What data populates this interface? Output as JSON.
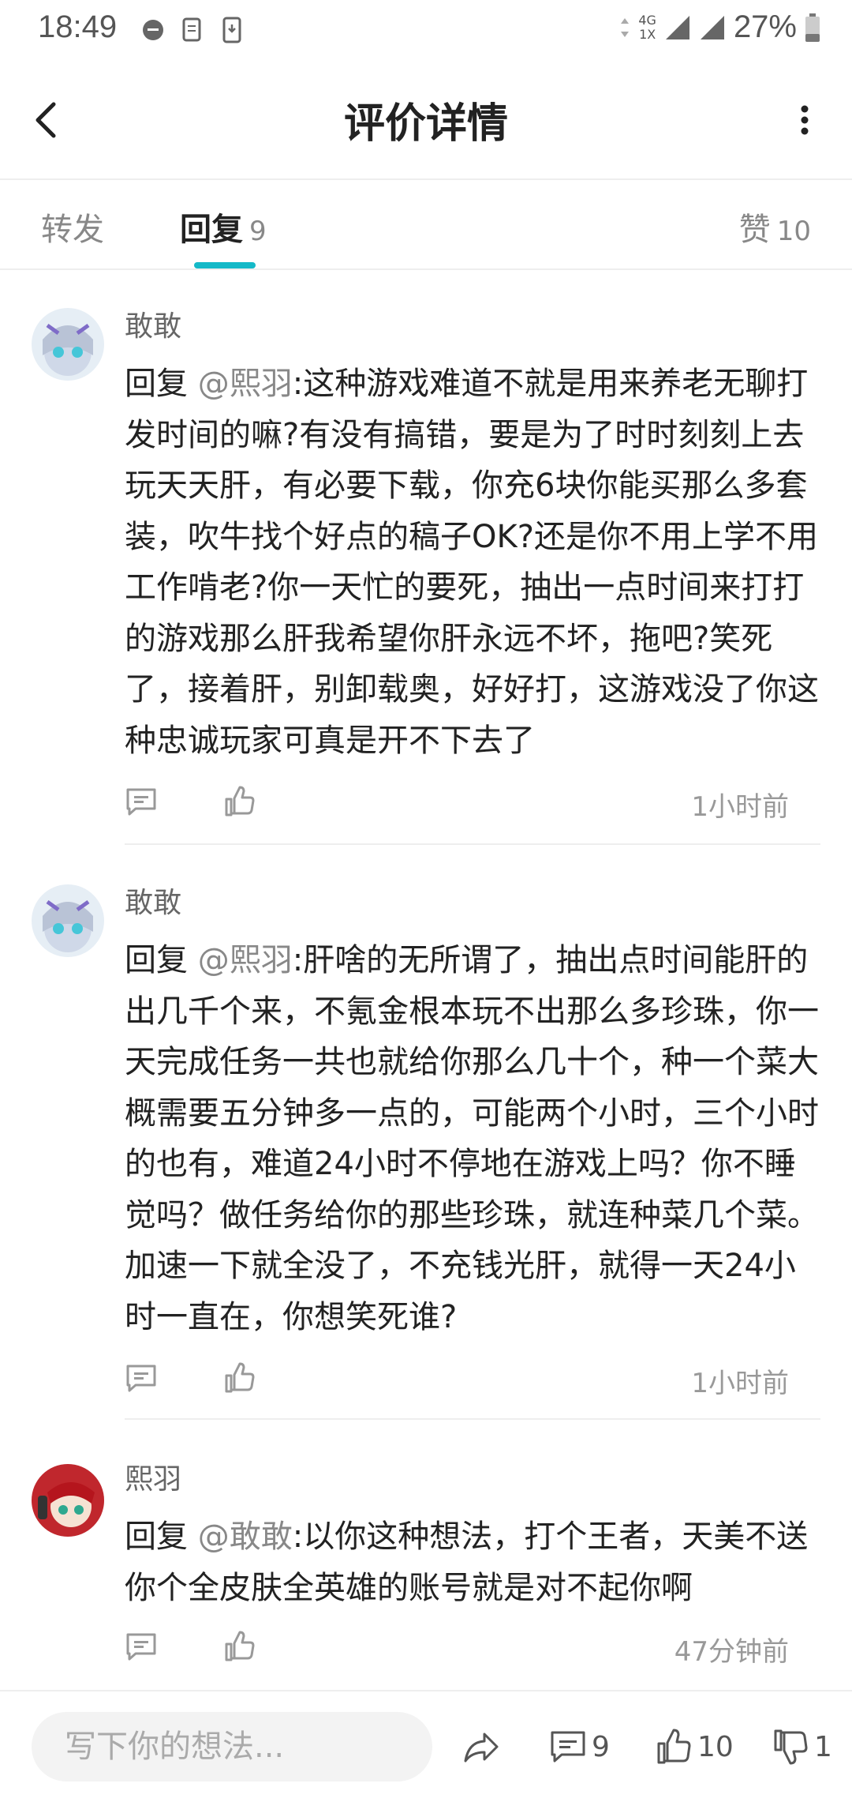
{
  "status_bar": {
    "time": "18:49",
    "network_top": "4G",
    "network_bottom": "1X",
    "battery": "27%"
  },
  "header": {
    "title": "评价详情"
  },
  "tabs": [
    {
      "label": "转发",
      "count": ""
    },
    {
      "label": "回复",
      "count": "9"
    },
    {
      "label": "赞",
      "count": "10"
    }
  ],
  "comments": [
    {
      "author": "敢敢",
      "reply_prefix": "回复",
      "mention": "@熙羽",
      "text": ":这种游戏难道不就是用来养老无聊打发时间的嘛?有没有搞错，要是为了时时刻刻上去玩天天肝，有必要下载，你充6块你能买那么多套装，吹牛找个好点的稿子OK?还是你不用上学不用工作啃老?你一天忙的要死，抽出一点时间来打打的游戏那么肝我希望你肝永远不坏，拖吧?笑死了，接着肝，别卸载奥，好好打，这游戏没了你这种忠诚玩家可真是开不下去了",
      "time": "1小时前"
    },
    {
      "author": "敢敢",
      "reply_prefix": "回复",
      "mention": "@熙羽",
      "text": ":肝啥的无所谓了，抽出点时间能肝的出几千个来，不氪金根本玩不出那么多珍珠，你一天完成任务一共也就给你那么几十个，种一个菜大概需要五分钟多一点的，可能两个小时，三个小时的也有，难道24小时不停地在游戏上吗？你不睡觉吗？做任务给你的那些珍珠，就连种菜几个菜。加速一下就全没了，不充钱光肝，就得一天24小时一直在，你想笑死谁?",
      "time": "1小时前"
    },
    {
      "author": "熙羽",
      "reply_prefix": "回复",
      "mention": "@敢敢",
      "text": ":以你这种想法，打个王者，天美不送你个全皮肤全英雄的账号就是对不起你啊",
      "time": "47分钟前"
    }
  ],
  "bottom_bar": {
    "input_placeholder": "写下你的想法...",
    "comment_count": "9",
    "like_count": "10",
    "dislike_count": "1"
  },
  "colors": {
    "accent": "#14b9c8",
    "mention": "#888888",
    "meta": "#999999"
  }
}
